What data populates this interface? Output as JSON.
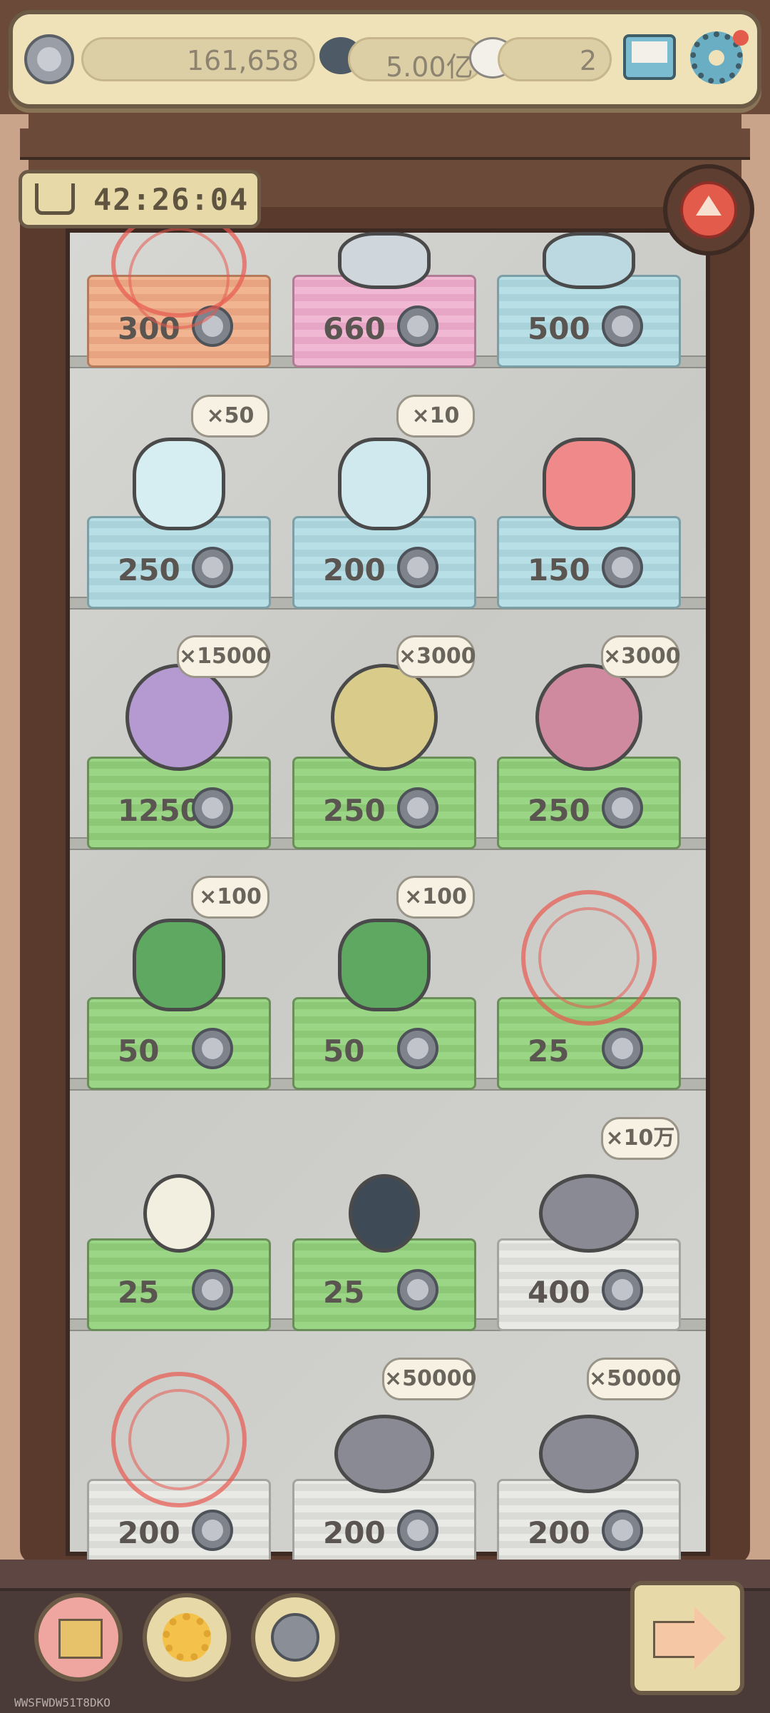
{
  "topbar": {
    "coins": "161,658",
    "bubbles": "5.00亿",
    "ghosts": "2"
  },
  "shop": {
    "timer": "42:26:04",
    "rows": [
      {
        "items": [
          {
            "name": "stamped-item",
            "price": "300",
            "slot": "orange",
            "qty": "",
            "purchased": true
          },
          {
            "name": "telescope",
            "price": "660",
            "slot": "pink",
            "qty": ""
          },
          {
            "name": "bucket",
            "price": "500",
            "slot": "blue",
            "qty": ""
          }
        ]
      },
      {
        "items": [
          {
            "name": "water-bottle",
            "price": "250",
            "slot": "blue",
            "qty": "×50"
          },
          {
            "name": "scroll-tube",
            "price": "200",
            "slot": "blue",
            "qty": "×10"
          },
          {
            "name": "mirror",
            "price": "150",
            "slot": "blue",
            "qty": ""
          }
        ]
      },
      {
        "items": [
          {
            "name": "purple-germ",
            "price": "1250",
            "slot": "green",
            "qty": "×15000"
          },
          {
            "name": "yellow-germ",
            "price": "250",
            "slot": "green",
            "qty": "×3000"
          },
          {
            "name": "red-germ",
            "price": "250",
            "slot": "green",
            "qty": "×3000"
          }
        ]
      },
      {
        "items": [
          {
            "name": "green-paint-bucket",
            "price": "50",
            "slot": "green",
            "qty": "×100"
          },
          {
            "name": "green-paint-bucket",
            "price": "50",
            "slot": "green",
            "qty": "×100"
          },
          {
            "name": "stamped-item",
            "price": "25",
            "slot": "green",
            "qty": "",
            "purchased": true
          }
        ]
      },
      {
        "items": [
          {
            "name": "white-pearl-pendant",
            "price": "25",
            "slot": "green",
            "qty": ""
          },
          {
            "name": "black-pearl-pendant",
            "price": "25",
            "slot": "green",
            "qty": ""
          },
          {
            "name": "speech-bubble",
            "price": "400",
            "slot": "white",
            "qty": "×10万"
          }
        ]
      },
      {
        "items": [
          {
            "name": "stamped-item",
            "price": "200",
            "slot": "white",
            "qty": "",
            "purchased": true
          },
          {
            "name": "speech-bubble",
            "price": "200",
            "slot": "white",
            "qty": "×50000"
          },
          {
            "name": "speech-bubble",
            "price": "200",
            "slot": "white",
            "qty": "×50000"
          }
        ]
      }
    ]
  },
  "watermark": "WWSFWDW51T8DKO",
  "colors": {
    "accent": "#e35b4a",
    "frame": "#5a3a2c",
    "panel": "#efe2b8"
  }
}
